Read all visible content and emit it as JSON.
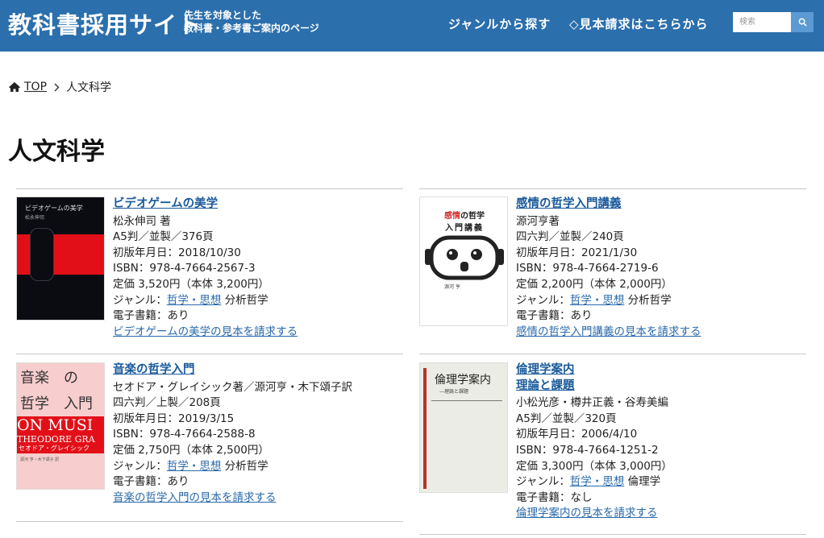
{
  "header": {
    "title": "教科書採用サイト",
    "subtitle_line1": "先生を対象とした",
    "subtitle_line2": "教科書・参考書ご案内のページ",
    "nav_genre": "ジャンルから探す",
    "nav_sample": "◇見本請求はこちらから",
    "search_placeholder": "検索",
    "accent_color": "#2b6fad"
  },
  "breadcrumb": {
    "home": "TOP",
    "current": "人文科学"
  },
  "page_title": "人文科学",
  "books": [
    {
      "title": "ビデオゲームの美学",
      "author": "松永伸司 著",
      "format": "A5判／並製／376頁",
      "date": "初版年月日：2018/10/30",
      "isbn": "ISBN：978-4-7664-2567-3",
      "price": "定価 3,520円（本体 3,200円）",
      "genre_prefix": "ジャンル：",
      "genre_link": "哲学・思想",
      "genre_sub": " 分析哲学",
      "ebook": "電子書籍：あり",
      "request": "ビデオゲームの美学の見本を請求する",
      "cover_title": "ビデオゲームの美学",
      "cover_author": "松永伸司"
    },
    {
      "title": "感情の哲学入門講義",
      "author": "源河亨著",
      "format": "四六判／並製／240頁",
      "date": "初版年月日：2021/1/30",
      "isbn": "ISBN：978-4-7664-2719-6",
      "price": "定価 2,200円（本体 2,000円）",
      "genre_prefix": "ジャンル：",
      "genre_link": "哲学・思想",
      "genre_sub": " 分析哲学",
      "ebook": "電子書籍：あり",
      "request": "感情の哲学入門講義の見本を請求する",
      "cover_title_a": "感情",
      "cover_title_b": "の哲学",
      "cover_title_c": "入門講義",
      "cover_author": "源河 亨"
    },
    {
      "title": "音楽の哲学入門",
      "author": "セオドア・グレイシック著／源河亨・木下頌子訳",
      "format": "四六判／上製／208頁",
      "date": "初版年月日：2019/3/15",
      "isbn": "ISBN：978-4-7664-2588-8",
      "price": "定価 2,750円（本体 2,500円）",
      "genre_prefix": "ジャンル：",
      "genre_link": "哲学・思想",
      "genre_sub": " 分析哲学",
      "ebook": "電子書籍：あり",
      "request": "音楽の哲学入門の見本を請求する",
      "cover_line1": "音楽　の",
      "cover_line2": "哲学　入門",
      "cover_en1": "ON MUSI",
      "cover_en2": "THEODORE GRA",
      "cover_kana": "セオドア・グレイシック",
      "cover_trans": "源河 亨・木下頌子 訳"
    },
    {
      "title_line1": "倫理学案内",
      "title_line2": "理論と課題",
      "author": "小松光彦・樽井正義・谷寿美編",
      "format": "A5判／並製／320頁",
      "date": "初版年月日：2006/4/10",
      "isbn": "ISBN：978-4-7664-1251-2",
      "price": "定価 3,300円（本体 3,000円）",
      "genre_prefix": "ジャンル：",
      "genre_link": "哲学・思想",
      "genre_sub": " 倫理学",
      "ebook": "電子書籍：なし",
      "request": "倫理学案内の見本を請求する",
      "cover_title": "倫理学案内",
      "cover_sub": "―理論と課題"
    }
  ]
}
